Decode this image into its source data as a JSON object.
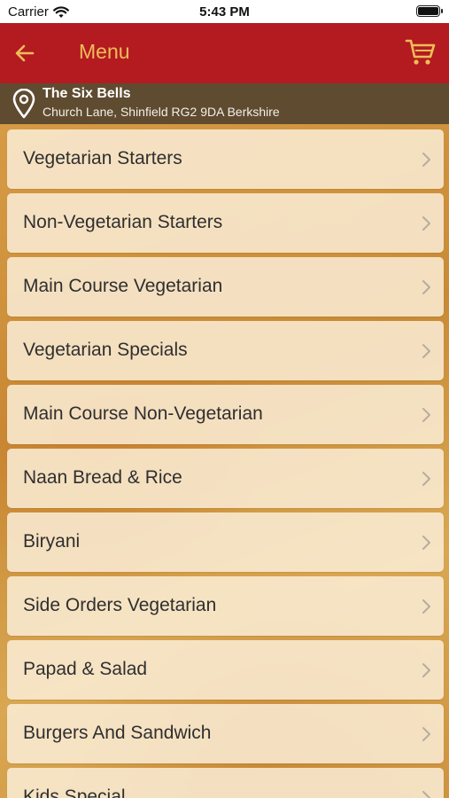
{
  "status_bar": {
    "carrier": "Carrier",
    "time": "5:43 PM"
  },
  "nav": {
    "title": "Menu",
    "back_icon": "arrow-left-icon",
    "cart_icon": "shopping-cart-icon"
  },
  "location": {
    "name": "The Six Bells",
    "address": "Church Lane, Shinfield RG2 9DA Berkshire",
    "icon": "map-pin-icon"
  },
  "menu": {
    "items": [
      {
        "label": "Vegetarian Starters"
      },
      {
        "label": "Non-Vegetarian Starters"
      },
      {
        "label": "Main Course Vegetarian"
      },
      {
        "label": "Vegetarian Specials"
      },
      {
        "label": "Main Course Non-Vegetarian"
      },
      {
        "label": "Naan Bread & Rice"
      },
      {
        "label": "Biryani"
      },
      {
        "label": "Side Orders Vegetarian"
      },
      {
        "label": "Papad & Salad"
      },
      {
        "label": "Burgers And Sandwich"
      },
      {
        "label": "Kids Special"
      }
    ]
  },
  "colors": {
    "nav_background": "#b31b20",
    "nav_accent": "#f1bc5a",
    "location_background": "#5f4b30",
    "item_background": "#faeed6"
  }
}
